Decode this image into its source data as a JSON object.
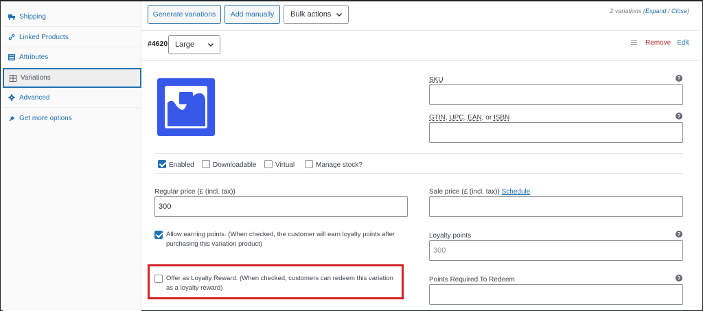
{
  "sidebar": {
    "items": [
      {
        "label": "Shipping",
        "icon": "truck-icon"
      },
      {
        "label": "Linked Products",
        "icon": "link-icon"
      },
      {
        "label": "Attributes",
        "icon": "list-icon"
      },
      {
        "label": "Variations",
        "icon": "grid-icon",
        "active": true
      },
      {
        "label": "Advanced",
        "icon": "gear-icon"
      },
      {
        "label": "Get more options",
        "icon": "plug-icon"
      }
    ]
  },
  "toolbar": {
    "generate_label": "Generate variations",
    "add_label": "Add manually",
    "bulk_label": "Bulk actions",
    "count_text": "2 variations (",
    "expand_label": "Expand",
    "divider": " / ",
    "close_label": "Close",
    "count_end": ")"
  },
  "variation": {
    "id": "#4620",
    "attribute_value": "Large",
    "remove_label": "Remove",
    "edit_label": "Edit"
  },
  "fields": {
    "sku_label": "SKU",
    "gtin_label_parts": [
      "GTIN",
      ", ",
      "UPC",
      ", ",
      "EAN",
      ", or ",
      "ISBN"
    ],
    "regular_price_label": "Regular price (£ (incl. tax))",
    "regular_price_value": "300",
    "sale_price_label": "Sale price (£ (incl. tax))",
    "schedule_label": "Schedule",
    "loyalty_points_label": "Loyalty points",
    "loyalty_points_placeholder": "300",
    "points_required_label": "Points Required To Redeem"
  },
  "options": {
    "enabled": {
      "label": "Enabled",
      "checked": true
    },
    "downloadable": {
      "label": "Downloadable",
      "checked": false
    },
    "virtual": {
      "label": "Virtual",
      "checked": false
    },
    "manage_stock": {
      "label": "Manage stock?",
      "checked": false
    }
  },
  "loyalty": {
    "earning_text": "Allow earning points. (When checked, the customer will earn loyalty points after purchasing this variation product)",
    "earning_checked": true,
    "reward_text": "Offer as Loyalty Reward. (When checked, customers can redeem this variation as a loyalty reward)",
    "reward_checked": false
  },
  "colors": {
    "accent": "#2271b1",
    "highlight": "#d32027",
    "thumbnail": "#3858e9",
    "remove": "#b32d2e"
  }
}
